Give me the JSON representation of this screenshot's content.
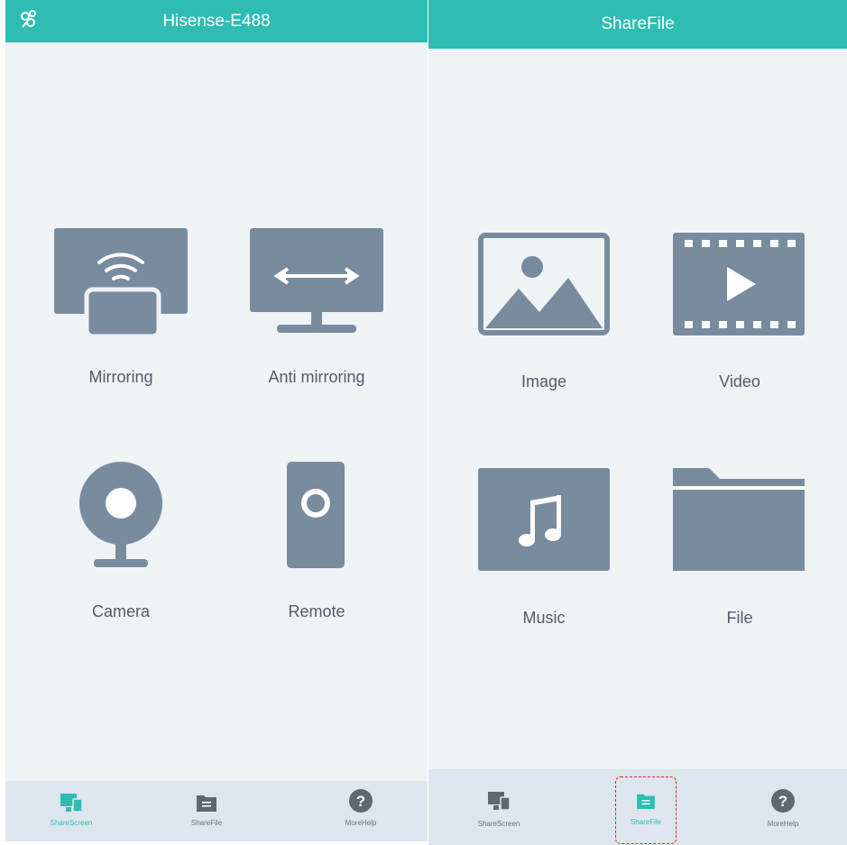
{
  "colors": {
    "header": "#2ebcb3",
    "background": "#eef3f5",
    "icon": "#798b9e",
    "tabbar": "#dde6ec",
    "active_tab": "#2ebcb3",
    "inactive_tab_icon": "#5f6770",
    "highlight": "#d9262c"
  },
  "share_screen": {
    "header": {
      "title": "Hisense-E488",
      "icon": "link-icon"
    },
    "tiles": [
      {
        "label": "Mirroring",
        "icon": "mirroring-icon"
      },
      {
        "label": "Anti mirroring",
        "icon": "anti-mirroring-icon"
      },
      {
        "label": "Camera",
        "icon": "camera-icon"
      },
      {
        "label": "Remote",
        "icon": "remote-icon"
      }
    ],
    "tabs": [
      {
        "label": "ShareScreen",
        "icon": "share-screen-icon",
        "active": true
      },
      {
        "label": "ShareFile",
        "icon": "share-file-icon",
        "active": false
      },
      {
        "label": "MoreHelp",
        "icon": "help-icon",
        "active": false
      }
    ]
  },
  "share_file": {
    "header": {
      "title": "ShareFile"
    },
    "tiles": [
      {
        "label": "Image",
        "icon": "image-icon"
      },
      {
        "label": "Video",
        "icon": "video-icon"
      },
      {
        "label": "Music",
        "icon": "music-icon"
      },
      {
        "label": "File",
        "icon": "folder-icon"
      }
    ],
    "tabs": [
      {
        "label": "ShareScreen",
        "icon": "share-screen-icon",
        "active": false
      },
      {
        "label": "ShareFile",
        "icon": "share-file-icon",
        "active": true
      },
      {
        "label": "MoreHelp",
        "icon": "help-icon",
        "active": false
      }
    ]
  }
}
